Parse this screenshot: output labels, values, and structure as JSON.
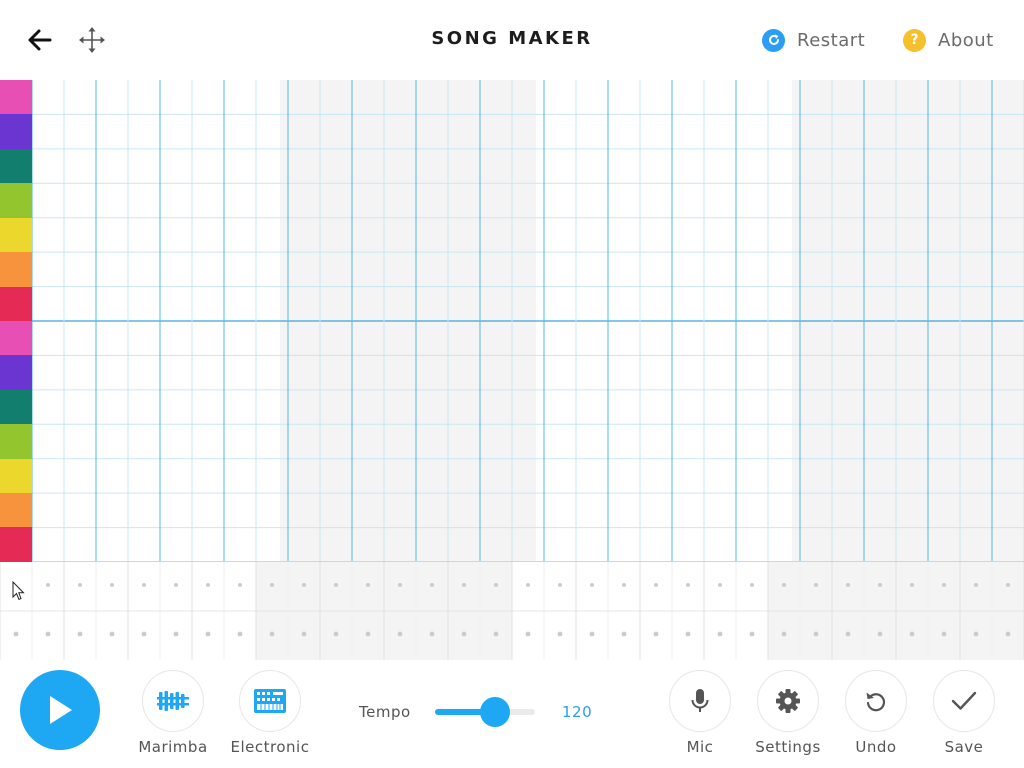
{
  "header": {
    "title": "SONG MAKER",
    "restart_label": "Restart",
    "about_label": "About",
    "about_glyph": "?",
    "icons": [
      "back-arrow-icon",
      "move-arrows-icon",
      "restart-icon",
      "help-icon"
    ]
  },
  "grid": {
    "note_colors": [
      "#e84fb4",
      "#6a35d1",
      "#127f6e",
      "#93c62e",
      "#ecd82d",
      "#f6933c",
      "#e52b55",
      "#e84fb4",
      "#6a35d1",
      "#127f6e",
      "#93c62e",
      "#ecd82d",
      "#f6933c",
      "#e52b55"
    ],
    "rows": 14,
    "columns": 31,
    "bars": 4,
    "accent_line": "#5ab4e0",
    "minor_line": "#c9e6f3",
    "shaded_bar_bg": "#f4f4f4"
  },
  "toolbar": {
    "marimba_label": "Marimba",
    "electronic_label": "Electronic",
    "tempo_label": "Tempo",
    "tempo_value": "120",
    "tempo_fraction": 0.6,
    "mic_label": "Mic",
    "settings_label": "Settings",
    "undo_label": "Undo",
    "save_label": "Save",
    "accent": "#1ea7f2",
    "icons": [
      "play-icon",
      "marimba-icon",
      "electronic-keyboard-icon",
      "mic-icon",
      "gear-icon",
      "undo-icon",
      "check-icon"
    ]
  }
}
